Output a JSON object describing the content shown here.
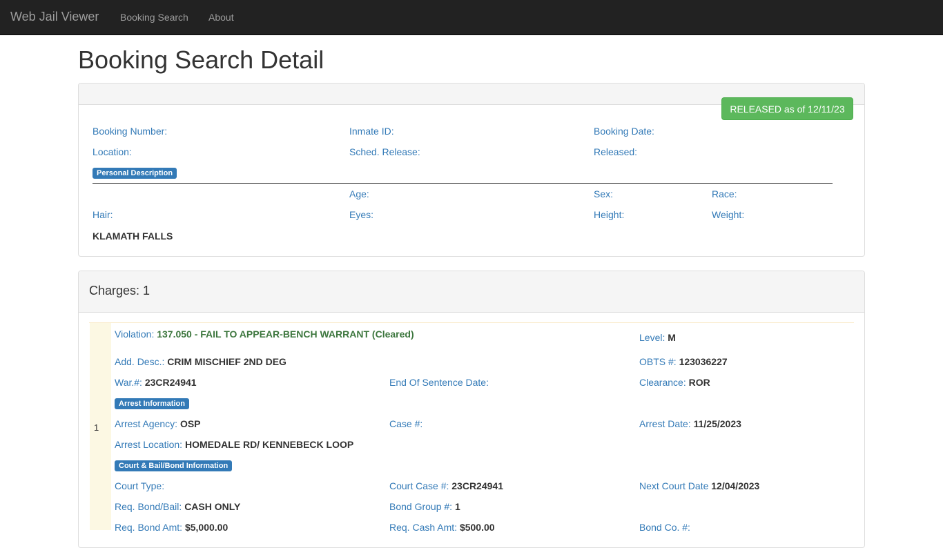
{
  "nav": {
    "brand": "Web Jail Viewer",
    "links": [
      "Booking Search",
      "About"
    ]
  },
  "page_title": "Booking Search Detail",
  "booking": {
    "status": "RELEASED as of 12/11/23",
    "booking_number_label": "Booking Number:",
    "inmate_id_label": "Inmate ID:",
    "booking_date_label": "Booking Date:",
    "location_label": "Location:",
    "sched_release_label": "Sched. Release:",
    "released_label": "Released:",
    "personal_description_badge": "Personal Description",
    "age_label": "Age:",
    "sex_label": "Sex:",
    "race_label": "Race:",
    "hair_label": "Hair:",
    "eyes_label": "Eyes:",
    "height_label": "Height:",
    "weight_label": "Weight:",
    "city": "KLAMATH FALLS"
  },
  "charges": {
    "title": "Charges: 1",
    "items": [
      {
        "number": "1",
        "violation_label": "Violation:",
        "violation": "137.050 - FAIL TO APPEAR-BENCH WARRANT (Cleared)",
        "level_label": "Level:",
        "level": "M",
        "add_desc_label": "Add. Desc.:",
        "add_desc": "CRIM MISCHIEF 2ND DEG",
        "obts_label": "OBTS #:",
        "obts": "123036227",
        "war_label": "War.#:",
        "war": "23CR24941",
        "end_sentence_label": "End Of Sentence Date:",
        "clearance_label": "Clearance:",
        "clearance": "ROR",
        "arrest_badge": "Arrest Information",
        "arrest_agency_label": "Arrest Agency:",
        "arrest_agency": "OSP",
        "case_label": "Case #:",
        "arrest_date_label": "Arrest Date:",
        "arrest_date": "11/25/2023",
        "arrest_location_label": "Arrest Location:",
        "arrest_location": "HOMEDALE RD/ KENNEBECK LOOP",
        "court_badge": "Court & Bail/Bond Information",
        "court_type_label": "Court Type:",
        "court_case_label": "Court Case #:",
        "court_case": "23CR24941",
        "next_court_label": "Next Court Date",
        "next_court": "12/04/2023",
        "req_bond_label": "Req. Bond/Bail:",
        "req_bond": "CASH ONLY",
        "bond_group_label": "Bond Group #:",
        "bond_group": "1",
        "req_bond_amt_label": "Req. Bond Amt:",
        "req_bond_amt": "$5,000.00",
        "req_cash_amt_label": "Req. Cash Amt:",
        "req_cash_amt": "$500.00",
        "bond_co_label": "Bond Co. #:"
      }
    ]
  }
}
